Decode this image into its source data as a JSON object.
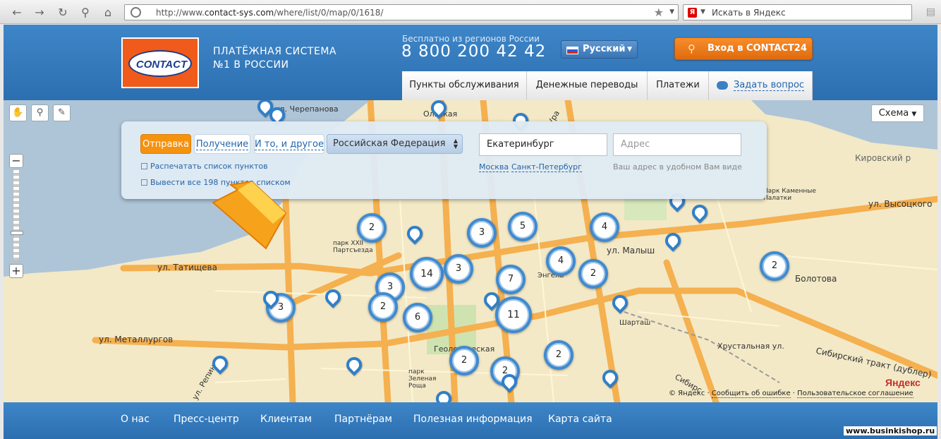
{
  "browser": {
    "url_prefix": "http://www.",
    "url_domain": "contact-sys.com",
    "url_path": "/where/list/0/map/0/1618/",
    "search_placeholder": "Искать в Яндекс",
    "search_engine_letter": "Я"
  },
  "header": {
    "logo_text": "CONTACT",
    "tagline": "ПЛАТЁЖНАЯ СИСТЕМА №1 В РОССИИ",
    "free_call_text": "Бесплатно из регионов России",
    "phone": "8 800 200 42 42",
    "language": "Русский",
    "login_button": "Вход в CONTACT24",
    "tabs": [
      {
        "label": "Пункты обслуживания"
      },
      {
        "label": "Денежные переводы"
      },
      {
        "label": "Платежи"
      },
      {
        "label": "Задать вопрос"
      }
    ]
  },
  "map": {
    "layer_button": "Схема",
    "search_panel": {
      "filters": [
        {
          "label": "Отправка",
          "active": true
        },
        {
          "label": "Получение",
          "active": false
        },
        {
          "label": "И то, и другое",
          "active": false
        }
      ],
      "country": "Российская Федерация",
      "city_value": "Екатеринбург",
      "address_placeholder": "Адрес",
      "city_links": [
        "Москва",
        "Санкт-Петербург"
      ],
      "address_hint": "Ваш адрес в удобном Вам виде",
      "print_link": "Распечатать список пунктов",
      "list_link": "Вывести все 198 пунктов списком"
    },
    "street_labels": [
      "ул. Татищева",
      "ул. Металлургов",
      "ул. Малыш",
      "ул. Высоцкого",
      "Сибирский тракт (дублер)",
      "Хрустальная ул.",
      "Кировский р",
      "парк XXII Партсъезда",
      "Геологическая",
      "парк Зеленая Роща",
      "Шарташ",
      "Болотова",
      "Парк Каменные Палатки",
      "ул. Репина",
      "Ольская",
      "Ура",
      "ул. Черепанова",
      "Энгель",
      "Сибирс"
    ],
    "clusters": [
      "2",
      "3",
      "5",
      "4",
      "14",
      "3",
      "4",
      "2",
      "3",
      "7",
      "2",
      "6",
      "11",
      "3",
      "2",
      "2",
      "2",
      "2"
    ],
    "copyright": "© Яндекс",
    "report_error": "Сообщить об ошибке",
    "user_agreement": "Пользовательское соглашение",
    "yandex_logo": "Яндекс"
  },
  "footer": {
    "items": [
      "О нас",
      "Пресс-центр",
      "Клиентам",
      "Партнёрам",
      "Полезная информация",
      "Карта сайта"
    ],
    "watermark": "www.businkishop.ru"
  },
  "colors": {
    "brand_blue": "#2f74b7",
    "accent_orange": "#f5920f",
    "map_background": "#f3e9c7",
    "water": "#aec5d8",
    "road": "#f5b04f"
  }
}
